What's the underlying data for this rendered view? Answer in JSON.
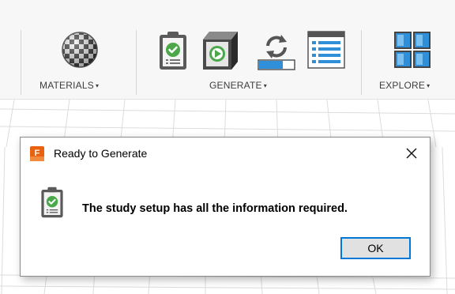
{
  "toolbar": {
    "groups": [
      {
        "label": "MATERIALS",
        "icons": [
          "material-checker-sphere-icon"
        ]
      },
      {
        "label": "GENERATE",
        "icons": [
          "precheck-clipboard-icon",
          "generate-play-icon",
          "sync-bar-icon",
          "list-panel-icon"
        ]
      },
      {
        "label": "EXPLORE",
        "icons": [
          "explore-grid-icon"
        ]
      }
    ],
    "caret": "▾"
  },
  "dialog": {
    "title": "Ready to Generate",
    "app_icon_letter": "F",
    "message": "The study setup has all the information required.",
    "ok_label": "OK",
    "close_glyph": "✕"
  },
  "colors": {
    "accent": "#0078d7",
    "check_green": "#4aa84a",
    "app_orange": "#e8620f",
    "icon_blue": "#2f8fd8"
  }
}
